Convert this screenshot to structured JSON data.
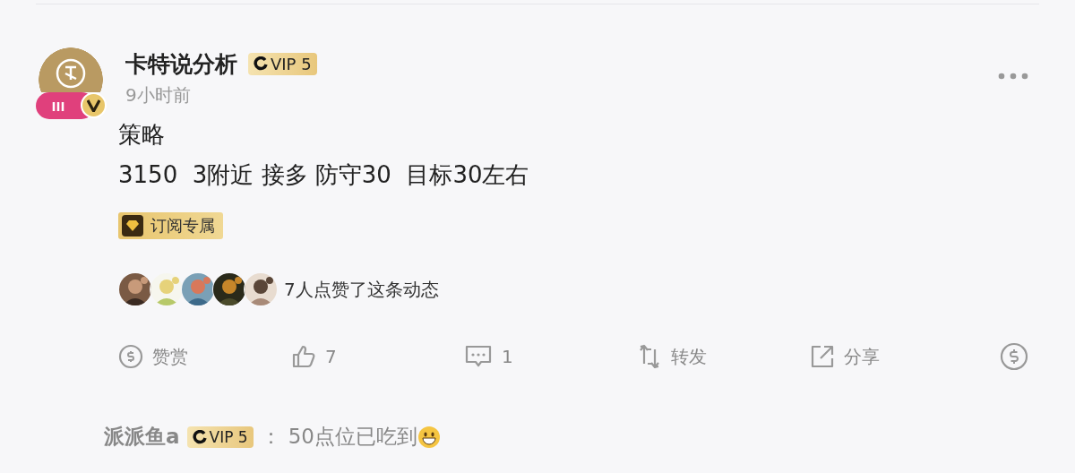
{
  "post": {
    "author": "卡特说分析",
    "vip": "VIP 5",
    "time": "9小时前",
    "title": "策略",
    "body": "3150  3附近 接多 防守30  目标30左右",
    "tag": "订阅专属",
    "likes": {
      "text": "7人点赞了这条动态"
    },
    "actions": [
      {
        "kind": "reward",
        "label": "赞赏"
      },
      {
        "kind": "like",
        "label": "7"
      },
      {
        "kind": "comment",
        "label": "1"
      },
      {
        "kind": "repost",
        "label": "转发"
      },
      {
        "kind": "share",
        "label": "分享"
      },
      {
        "kind": "coin"
      }
    ]
  },
  "comment": {
    "author": "派派鱼a",
    "vip": "VIP 5",
    "sep": "：",
    "text": "50点位已吃到"
  }
}
